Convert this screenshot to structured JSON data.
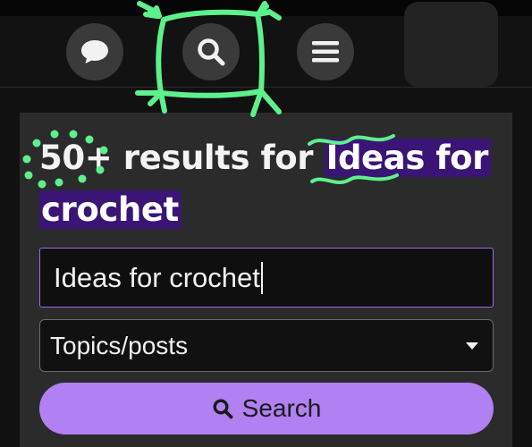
{
  "colors": {
    "accent_purple": "#b180f2",
    "highlight_purple": "#3a1575",
    "annotation_green": "#5ef08c",
    "card_bg": "#2b2b2b"
  },
  "header": {
    "buttons": [
      {
        "name": "chat",
        "icon": "chat-bubble-icon"
      },
      {
        "name": "search",
        "icon": "search-icon"
      },
      {
        "name": "menu",
        "icon": "hamburger-menu-icon"
      }
    ]
  },
  "results": {
    "count": "50+",
    "mid_text": " results for ",
    "query_highlight": "Ideas for crochet"
  },
  "search_form": {
    "query_value": "Ideas for crochet",
    "type_select": "Topics/posts",
    "submit_label": "Search"
  }
}
